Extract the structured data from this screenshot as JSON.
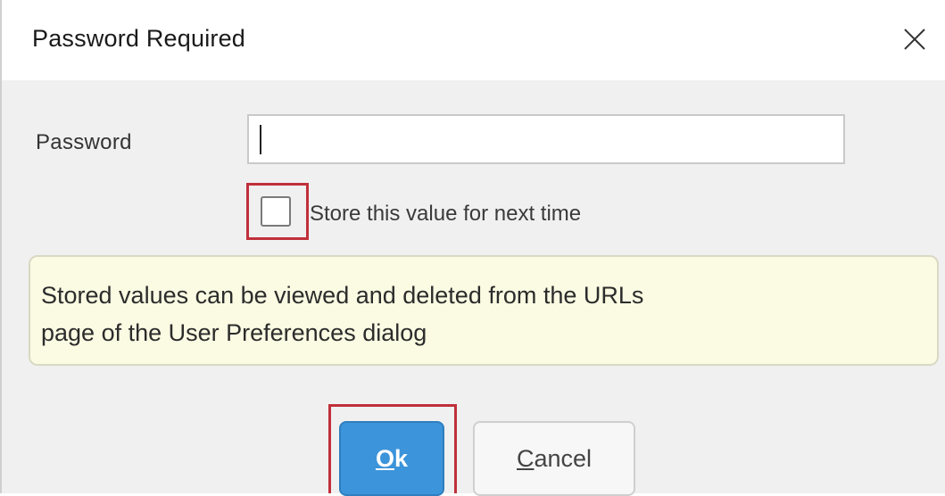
{
  "window": {
    "title": "Password Required",
    "close_icon": "close-icon"
  },
  "form": {
    "password_label": "Password",
    "password_value": "",
    "store_checkbox_checked": false,
    "store_label": "Store this value for next time"
  },
  "info": {
    "line1": "Stored values can be viewed and deleted from the URLs",
    "line2": "page of the User Preferences dialog"
  },
  "buttons": {
    "ok_access_key": "O",
    "ok_rest": "k",
    "cancel_access_key": "C",
    "cancel_rest": "ancel"
  },
  "colors": {
    "ok_button": "#3c94da",
    "highlight_border": "#c0303a",
    "info_background": "#fbfbe3"
  }
}
